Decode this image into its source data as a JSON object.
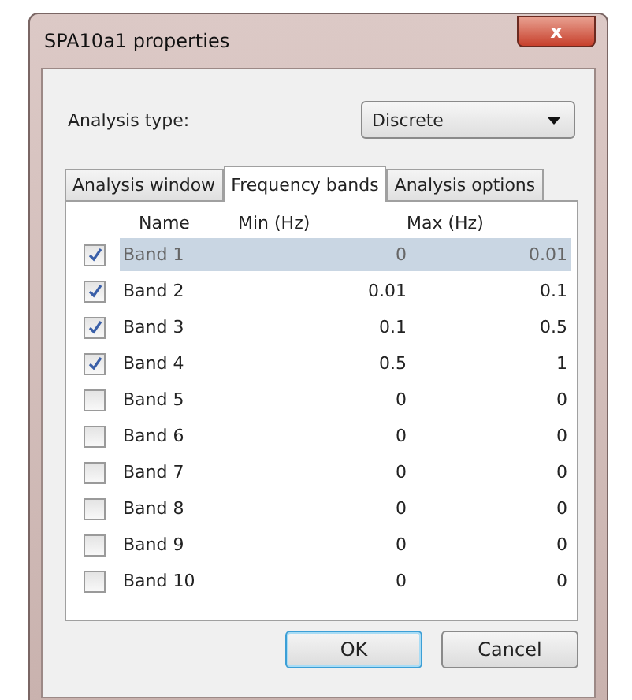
{
  "window": {
    "title": "SPA10a1 properties",
    "close": "x"
  },
  "analysis_type": {
    "label": "Analysis type:",
    "value": "Discrete"
  },
  "tabs": [
    {
      "label": "Analysis window",
      "selected": false
    },
    {
      "label": "Frequency bands",
      "selected": true
    },
    {
      "label": "Analysis options",
      "selected": false
    }
  ],
  "table": {
    "columns": [
      "Name",
      "Min (Hz)",
      "Max (Hz)"
    ],
    "rows": [
      {
        "name": "Band 1",
        "min": "0",
        "max": "0.01",
        "checked": true,
        "selected": true
      },
      {
        "name": "Band 2",
        "min": "0.01",
        "max": "0.1",
        "checked": true,
        "selected": false
      },
      {
        "name": "Band 3",
        "min": "0.1",
        "max": "0.5",
        "checked": true,
        "selected": false
      },
      {
        "name": "Band 4",
        "min": "0.5",
        "max": "1",
        "checked": true,
        "selected": false
      },
      {
        "name": "Band 5",
        "min": "0",
        "max": "0",
        "checked": false,
        "selected": false
      },
      {
        "name": "Band 6",
        "min": "0",
        "max": "0",
        "checked": false,
        "selected": false
      },
      {
        "name": "Band 7",
        "min": "0",
        "max": "0",
        "checked": false,
        "selected": false
      },
      {
        "name": "Band 8",
        "min": "0",
        "max": "0",
        "checked": false,
        "selected": false
      },
      {
        "name": "Band 9",
        "min": "0",
        "max": "0",
        "checked": false,
        "selected": false
      },
      {
        "name": "Band 10",
        "min": "0",
        "max": "0",
        "checked": false,
        "selected": false
      }
    ]
  },
  "buttons": [
    "OK",
    "Cancel"
  ]
}
